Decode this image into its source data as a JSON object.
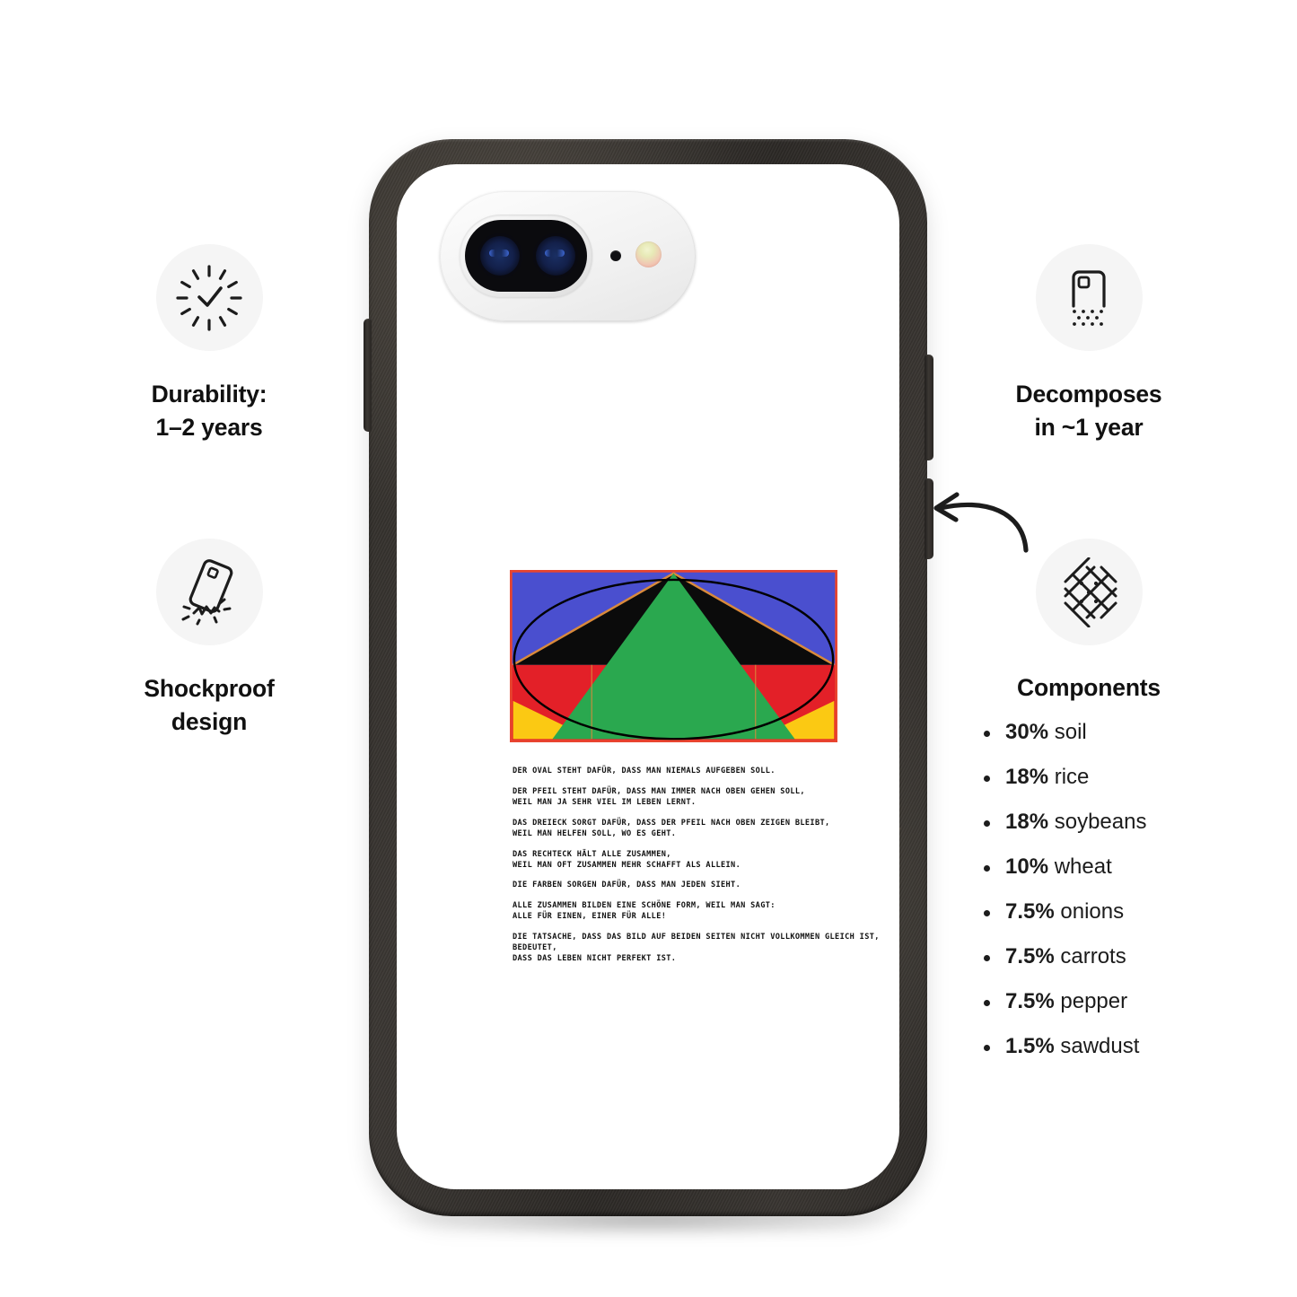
{
  "product": {
    "type": "biodegradable-phone-case",
    "case_color": "#2f2c28",
    "back_color": "#ffffff"
  },
  "features": {
    "durability": {
      "icon": "burst-check-icon",
      "line1": "Durability:",
      "line2": "1–2 years"
    },
    "shockproof": {
      "icon": "phone-impact-icon",
      "line1": "Shockproof",
      "line2": "design"
    },
    "decomposes": {
      "icon": "case-dissolving-dots-icon",
      "line1": "Decomposes",
      "line2": "in ~1 year"
    },
    "components": {
      "icon": "lattice-crosshatch-icon",
      "title": "Components",
      "items": [
        {
          "percent": "30%",
          "material": "soil"
        },
        {
          "percent": "18%",
          "material": "rice"
        },
        {
          "percent": "18%",
          "material": "soybeans"
        },
        {
          "percent": "10%",
          "material": "wheat"
        },
        {
          "percent": "7.5%",
          "material": "onions"
        },
        {
          "percent": "7.5%",
          "material": "carrots"
        },
        {
          "percent": "7.5%",
          "material": "pepper"
        },
        {
          "percent": "1.5%",
          "material": "sawdust"
        }
      ]
    }
  },
  "artwork": {
    "name": "geometric-composition",
    "colors": {
      "blue": "#4a4fcf",
      "red": "#e32028",
      "green": "#2aa84f",
      "black": "#0b0b0b",
      "yellow": "#fbc913",
      "purple": "#a25ba0",
      "outline": "#d98a3c",
      "ellipse": "#000000"
    }
  },
  "case_text": {
    "paragraphs": [
      {
        "lines": [
          "Der Oval steht dafür, dass man niemals aufgeben soll."
        ]
      },
      {
        "lines": [
          "Der Pfeil steht dafür, dass man immer nach oben gehen soll,",
          "weil man ja sehr viel im Leben lernt."
        ]
      },
      {
        "lines": [
          "Das Dreieck sorgt dafür, dass der Pfeil nach oben zeigen bleibt,",
          "weil man helfen soll, wo es geht."
        ]
      },
      {
        "lines": [
          "Das Rechteck hält alle zusammen,",
          "weil man oft zusammen mehr schafft als allein."
        ]
      },
      {
        "lines": [
          "Die Farben sorgen dafür, dass man jeden sieht."
        ]
      },
      {
        "lines": [
          "Alle zusammen bilden eine schöne Form, weil man sagt:",
          "Alle für einen, einer für alle!"
        ]
      },
      {
        "lines": [
          "Die Tatsache, dass das Bild auf beiden Seiten nicht vollkommen gleich ist,",
          "bedeutet,",
          "dass das Leben nicht perfekt ist."
        ]
      }
    ]
  },
  "annotation": {
    "arrow": "curved-arrow-pointing-to-case-edge"
  }
}
